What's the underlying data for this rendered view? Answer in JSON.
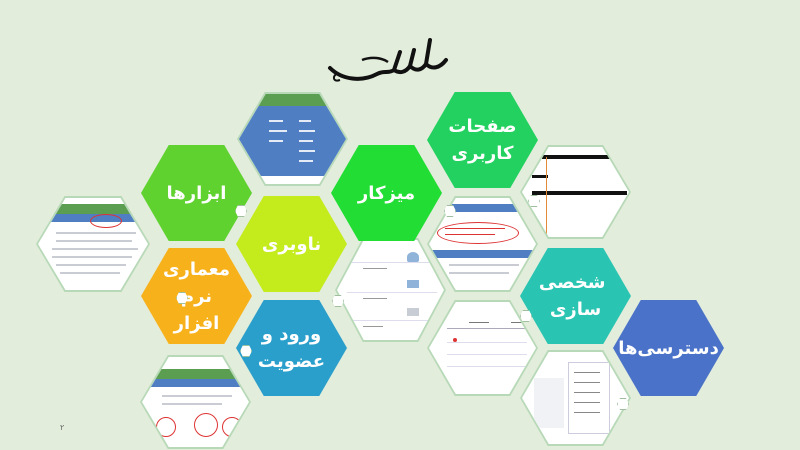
{
  "slide": {
    "page_number": "۲",
    "colors": {
      "background": "#e2eddb",
      "green": "#22d15f",
      "lime_green": "#5fd22f",
      "yellow_green": "#c4eb1c",
      "orange": "#f7b11b",
      "teal": "#29c4b2",
      "blue": "#2b9fcb",
      "navy": "#4a72c9"
    }
  },
  "hexagons": {
    "user_pages": {
      "label": "صفحات کاربری"
    },
    "dashboard": {
      "label": "میزکار"
    },
    "tools": {
      "label": "ابزارها"
    },
    "navigation": {
      "label": "ناوبری"
    },
    "architecture": {
      "label": "معماری نرم افزار"
    },
    "login": {
      "label": "ورود و عضویت"
    },
    "personalization": {
      "label": "شخصی سازی"
    },
    "access": {
      "label": "دسترسی‌ها"
    }
  },
  "icons": {
    "bismillah": "bismillah-calligraphy-icon"
  }
}
